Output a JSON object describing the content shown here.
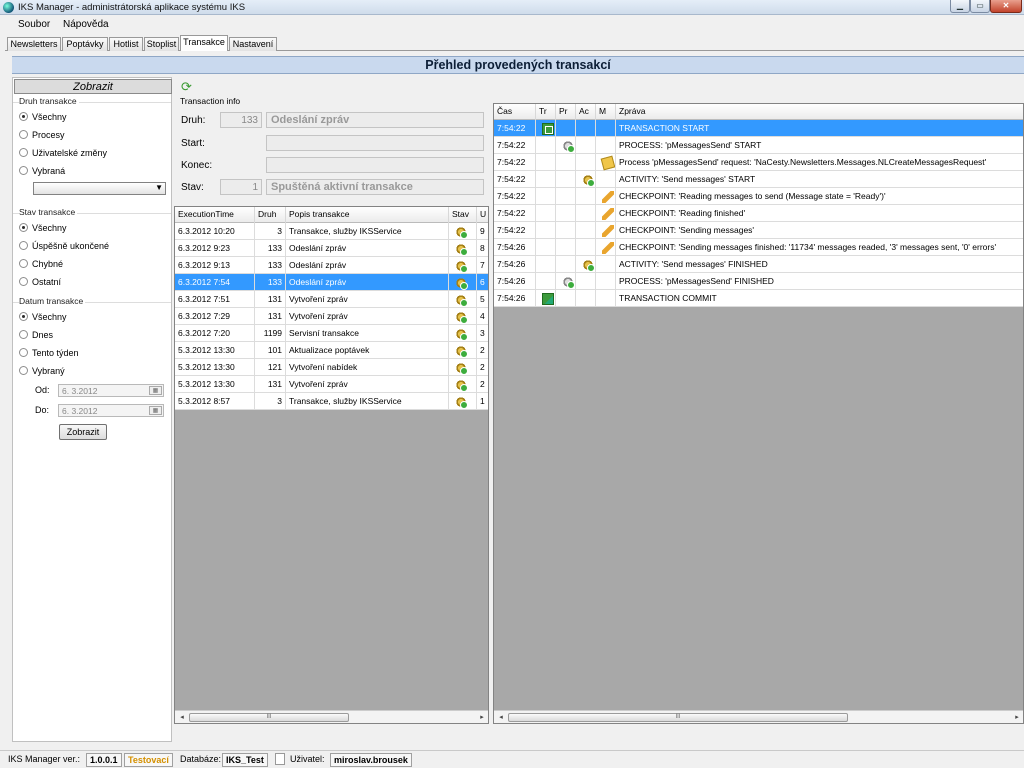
{
  "window": {
    "title": "IKS Manager - administrátorská aplikace systému IKS"
  },
  "menu": [
    "Soubor",
    "Nápověda"
  ],
  "tabs": [
    "Newsletters",
    "Poptávky",
    "Hotlist",
    "Stoplist",
    "Transakce",
    "Nastavení"
  ],
  "active_tab": "Transakce",
  "banner": "Přehled provedených transakcí",
  "left": {
    "header": "Zobrazit",
    "druh": {
      "title": "Druh transakce",
      "options": [
        "Všechny",
        "Procesy",
        "Uživatelské změny",
        "Vybraná"
      ],
      "selected": "Všechny"
    },
    "stav": {
      "title": "Stav transakce",
      "options": [
        "Všechny",
        "Úspěšně ukončené",
        "Chybné",
        "Ostatní"
      ],
      "selected": "Všechny"
    },
    "datum": {
      "title": "Datum transakce",
      "options": [
        "Všechny",
        "Dnes",
        "Tento týden",
        "Vybraný"
      ],
      "selected": "Všechny",
      "od_label": "Od:",
      "od_value": "6.  3.2012",
      "do_label": "Do:",
      "do_value": "6.  3.2012"
    },
    "button": "Zobrazit"
  },
  "info": {
    "title": "Transaction info",
    "druh_label": "Druh:",
    "druh_num": "133",
    "druh_text": "Odeslání zpráv",
    "start_label": "Start:",
    "start_value": "",
    "konec_label": "Konec:",
    "konec_value": "",
    "stav_label": "Stav:",
    "stav_num": "1",
    "stav_text": "Spuštěná aktivní transakce"
  },
  "transactions": {
    "columns": [
      "ExecutionTime",
      "Druh",
      "Popis transakce",
      "Stav",
      "U"
    ],
    "rows": [
      {
        "time": "6.3.2012 10:20",
        "druh": "3",
        "popis": "Transakce, služby IKSService",
        "u": "9",
        "sel": false
      },
      {
        "time": "6.3.2012 9:23",
        "druh": "133",
        "popis": "Odeslání zpráv",
        "u": "8",
        "sel": false
      },
      {
        "time": "6.3.2012 9:13",
        "druh": "133",
        "popis": "Odeslání zpráv",
        "u": "7",
        "sel": false
      },
      {
        "time": "6.3.2012 7:54",
        "druh": "133",
        "popis": "Odeslání zpráv",
        "u": "6",
        "sel": true
      },
      {
        "time": "6.3.2012 7:51",
        "druh": "131",
        "popis": "Vytvoření zpráv",
        "u": "5",
        "sel": false
      },
      {
        "time": "6.3.2012 7:29",
        "druh": "131",
        "popis": "Vytvoření zpráv",
        "u": "4",
        "sel": false
      },
      {
        "time": "6.3.2012 7:20",
        "druh": "1199",
        "popis": "Servisní transakce",
        "u": "3",
        "sel": false
      },
      {
        "time": "5.3.2012 13:30",
        "druh": "101",
        "popis": "Aktualizace poptávek",
        "u": "2",
        "sel": false
      },
      {
        "time": "5.3.2012 13:30",
        "druh": "121",
        "popis": "Vytvoření nabídek",
        "u": "2",
        "sel": false
      },
      {
        "time": "5.3.2012 13:30",
        "druh": "131",
        "popis": "Vytvoření zpráv",
        "u": "2",
        "sel": false
      },
      {
        "time": "5.3.2012 8:57",
        "druh": "3",
        "popis": "Transakce, služby IKSService",
        "u": "1",
        "sel": false
      }
    ]
  },
  "messages": {
    "columns": [
      "Čas",
      "Tr",
      "Pr",
      "Ac",
      "M",
      "Zpráva"
    ],
    "rows": [
      {
        "time": "7:54:22",
        "icon_col": 1,
        "icon": "tstart",
        "text": "TRANSACTION START",
        "sel": true
      },
      {
        "time": "7:54:22",
        "icon_col": 2,
        "icon": "gear-gray",
        "text": "PROCESS: 'pMessagesSend' START",
        "sel": false
      },
      {
        "time": "7:54:22",
        "icon_col": 4,
        "icon": "env",
        "text": "Process 'pMessagesSend' request: 'NaCesty.Newsletters.Messages.NLCreateMessagesRequest'",
        "sel": false
      },
      {
        "time": "7:54:22",
        "icon_col": 3,
        "icon": "gear",
        "text": "ACTIVITY: 'Send messages' START",
        "sel": false
      },
      {
        "time": "7:54:22",
        "icon_col": 4,
        "icon": "pencil",
        "text": "CHECKPOINT: 'Reading messages to send (Message state = 'Ready')'",
        "sel": false
      },
      {
        "time": "7:54:22",
        "icon_col": 4,
        "icon": "pencil",
        "text": "CHECKPOINT: 'Reading finished'",
        "sel": false
      },
      {
        "time": "7:54:22",
        "icon_col": 4,
        "icon": "pencil",
        "text": "CHECKPOINT: 'Sending messages'",
        "sel": false
      },
      {
        "time": "7:54:26",
        "icon_col": 4,
        "icon": "pencil",
        "text": "CHECKPOINT: 'Sending messages finished: '11734' messages readed, '3' messages sent, '0' errors'",
        "sel": false
      },
      {
        "time": "7:54:26",
        "icon_col": 3,
        "icon": "gear",
        "text": "ACTIVITY: 'Send messages' FINISHED",
        "sel": false
      },
      {
        "time": "7:54:26",
        "icon_col": 2,
        "icon": "gear-gray",
        "text": "PROCESS: 'pMessagesSend' FINISHED",
        "sel": false
      },
      {
        "time": "7:54:26",
        "icon_col": 1,
        "icon": "tcommit",
        "text": "TRANSACTION COMMIT",
        "sel": false
      }
    ]
  },
  "scroll_thumb": "III",
  "statusbar": {
    "ver_label": "IKS Manager ver.:",
    "ver_value": "1.0.0.1",
    "env": "Testovací",
    "db_label": "Databáze:",
    "db_value": "IKS_Test",
    "user_label": "Uživatel:",
    "user_value": "miroslav.brousek"
  },
  "colors": {
    "selection": "#3399ff",
    "banner": "#c9d9ee",
    "env_text": "#d49000"
  }
}
